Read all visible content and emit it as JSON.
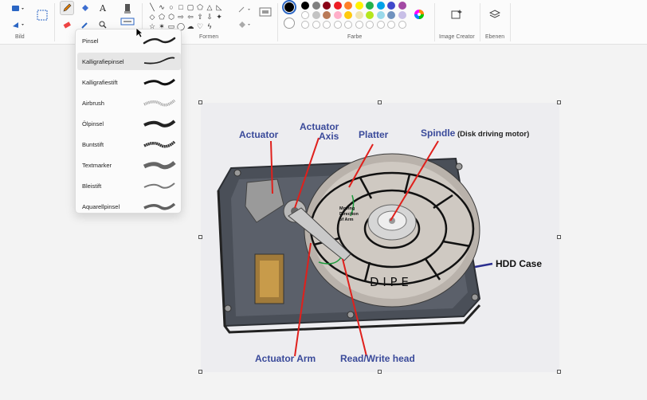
{
  "ribbon": {
    "groups": {
      "image": "Bild",
      "shapes": "Formen",
      "colors": "Farbe",
      "image_creator": "Image Creator",
      "layers": "Ebenen"
    },
    "colors": {
      "primary": "#000000",
      "secondary": "#ffffff",
      "palette_row1": [
        "#000000",
        "#7f7f7f",
        "#880015",
        "#ed1c24",
        "#ff7f27",
        "#fff200",
        "#22b14c",
        "#00a2e8",
        "#3f48cc",
        "#a349a4"
      ],
      "palette_row2": [
        "#ffffff",
        "#c3c3c3",
        "#b97a57",
        "#ffaec9",
        "#ffc90e",
        "#efe4b0",
        "#b5e61d",
        "#99d9ea",
        "#7092be",
        "#c8bfe7"
      ]
    }
  },
  "brush_menu": {
    "items": [
      {
        "label": "Pinsel"
      },
      {
        "label": "Kalligrafiepinsel"
      },
      {
        "label": "Kalligrafiestift"
      },
      {
        "label": "Airbrush"
      },
      {
        "label": "Ölpinsel"
      },
      {
        "label": "Buntstift"
      },
      {
        "label": "Textmarker"
      },
      {
        "label": "Bleistift"
      },
      {
        "label": "Aquarellpinsel"
      }
    ],
    "selected": "Kalligrafiepinsel"
  },
  "diagram": {
    "labels": {
      "actuator": "Actuator",
      "actuator_axis": "Actuator Axis",
      "platter": "Platter",
      "spindle": "Spindle",
      "spindle_note": "(Disk driving motor)",
      "hdd_case": "HDD Case",
      "actuator_arm": "Actuator Arm",
      "rw_head": "Read/Write head",
      "moving_direction": "Moving Direction of Arm",
      "disk_text": "D I P E"
    }
  }
}
